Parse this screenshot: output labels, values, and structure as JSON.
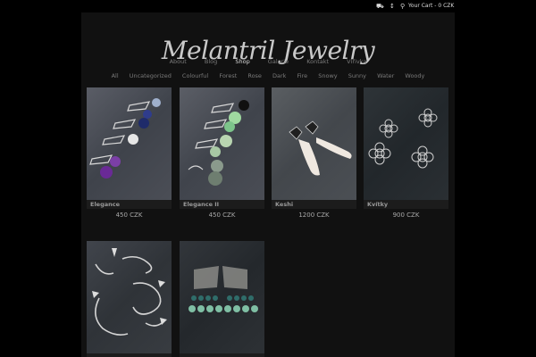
{
  "topbar": {
    "cart_text": "Your Cart - 0 CZK",
    "icons": [
      "truck-icon",
      "info-icon",
      "cart-icon"
    ]
  },
  "header": {
    "logo": "Melantril Jewelry"
  },
  "nav": {
    "items": [
      "About",
      "Blog",
      "Shop",
      "Galerie",
      "Kontakt",
      "Vířivka"
    ],
    "active": "Shop"
  },
  "categories": [
    "All",
    "Uncategorized",
    "Colourful",
    "Forest",
    "Rose",
    "Dark",
    "Fire",
    "Snowy",
    "Sunny",
    "Water",
    "Woody"
  ],
  "products": [
    {
      "name": "Elegance",
      "price": "450 CZK"
    },
    {
      "name": "Elegance II",
      "price": "450 CZK"
    },
    {
      "name": "Keshi",
      "price": "1200 CZK"
    },
    {
      "name": "Kvítky",
      "price": "900 CZK"
    },
    {
      "name": "",
      "price": ""
    },
    {
      "name": "",
      "price": ""
    }
  ],
  "colors": {
    "background": "#000000",
    "panel": "#111111",
    "text": "#888888",
    "active": "#d8d8d8"
  }
}
